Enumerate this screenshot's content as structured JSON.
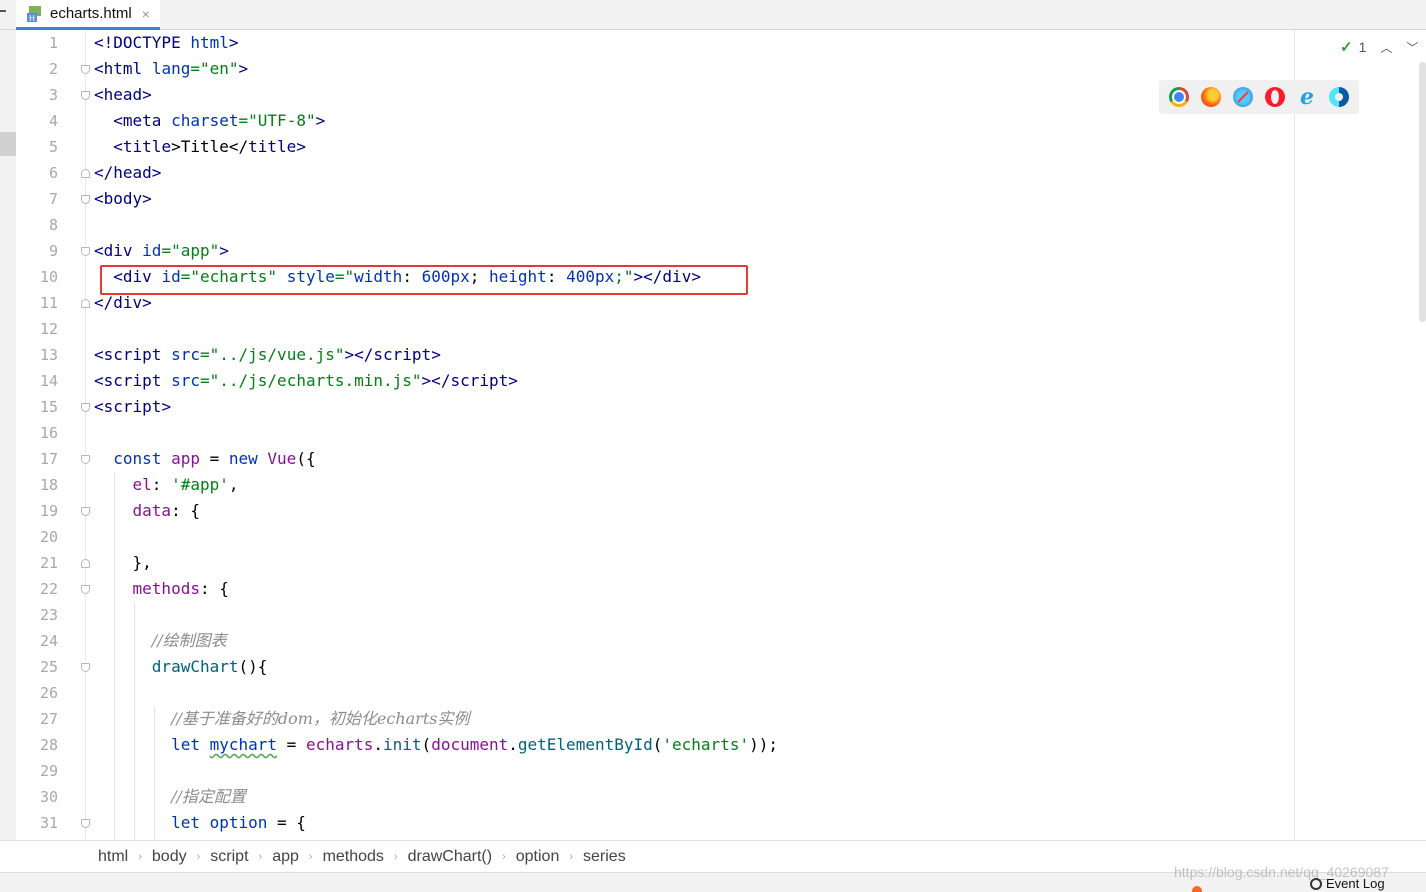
{
  "tab": {
    "filename": "echarts.html",
    "close": "×"
  },
  "inspection": {
    "count": "1"
  },
  "browsers": [
    "chrome-icon",
    "firefox-icon",
    "safari-icon",
    "opera-icon",
    "ie-icon",
    "edge-icon"
  ],
  "line_numbers": [
    "1",
    "2",
    "3",
    "4",
    "5",
    "6",
    "7",
    "8",
    "9",
    "10",
    "11",
    "12",
    "13",
    "14",
    "15",
    "16",
    "17",
    "18",
    "19",
    "20",
    "21",
    "22",
    "23",
    "24",
    "25",
    "26",
    "27",
    "28",
    "29",
    "30",
    "31"
  ],
  "code": {
    "l1": {
      "a": "<!DOCTYPE ",
      "b": "html",
      "c": ">"
    },
    "l2": {
      "a": "<",
      "b": "html ",
      "c": "lang",
      "d": "=",
      "e": "\"en\"",
      "f": ">"
    },
    "l3": {
      "a": "<",
      "b": "head",
      "c": ">"
    },
    "l4": {
      "a": "  <",
      "b": "meta ",
      "c": "charset",
      "d": "=",
      "e": "\"UTF-8\"",
      "f": ">"
    },
    "l5": {
      "a": "  <",
      "b": "title",
      "c": ">Title</",
      "d": "title",
      "e": ">"
    },
    "l6": {
      "a": "</",
      "b": "head",
      "c": ">"
    },
    "l7": {
      "a": "<",
      "b": "body",
      "c": ">"
    },
    "l9": {
      "a": "<",
      "b": "div ",
      "c": "id",
      "d": "=",
      "e": "\"app\"",
      "f": ">"
    },
    "l10": {
      "a": "  <",
      "b": "div ",
      "c": "id",
      "d": "=",
      "e": "\"echarts\"",
      "f": " ",
      "g": "style",
      "h": "=",
      "i": "\"",
      "j": "width",
      "k": ": ",
      "l": "600px",
      "m": "; ",
      "n": "height",
      "o": ": ",
      "p": "400px",
      "q": ";\"",
      "r": "></",
      "s": "div",
      "t": ">"
    },
    "l11": {
      "a": "</",
      "b": "div",
      "c": ">"
    },
    "l13": {
      "a": "<",
      "b": "script ",
      "c": "src",
      "d": "=",
      "e": "\"../js/vue.js\"",
      "f": "></",
      "g": "script",
      "h": ">"
    },
    "l14": {
      "a": "<",
      "b": "script ",
      "c": "src",
      "d": "=",
      "e": "\"../js/echarts.min.js\"",
      "f": "></",
      "g": "script",
      "h": ">"
    },
    "l15": {
      "a": "<",
      "b": "script",
      "c": ">"
    },
    "l17": {
      "a": "  ",
      "b": "const ",
      "c": "app",
      "d": " = ",
      "e": "new ",
      "f": "Vue",
      "g": "({"
    },
    "l18": {
      "a": "    ",
      "b": "el",
      "c": ": ",
      "d": "'#app'",
      "e": ","
    },
    "l19": {
      "a": "    ",
      "b": "data",
      "c": ": {"
    },
    "l21": {
      "a": "    },"
    },
    "l22": {
      "a": "    ",
      "b": "methods",
      "c": ": {"
    },
    "l24": {
      "a": "      ",
      "b": "//绘制图表"
    },
    "l25": {
      "a": "      ",
      "b": "drawChart",
      "c": "(){"
    },
    "l27": {
      "a": "        ",
      "b": "//基于准备好的dom，初始化echarts实例"
    },
    "l28": {
      "a": "        ",
      "b": "let ",
      "c": "mychart",
      "d": " = ",
      "e": "echarts",
      "f": ".",
      "g": "init",
      "h": "(",
      "i": "document",
      "j": ".",
      "k": "getElementById",
      "l": "(",
      "m": "'echarts'",
      "n": "));"
    },
    "l30": {
      "a": "        ",
      "b": "//指定配置"
    },
    "l31": {
      "a": "        ",
      "b": "let ",
      "c": "option",
      "d": " = {"
    }
  },
  "breadcrumb": [
    "html",
    "body",
    "script",
    "app",
    "methods",
    "drawChart()",
    "option",
    "series"
  ],
  "watermark": "https://blog.csdn.net/qq_40269087",
  "event_log": "Event Log",
  "colors": {
    "highlight_box": "#e53935",
    "tab_underline": "#4083c9"
  }
}
